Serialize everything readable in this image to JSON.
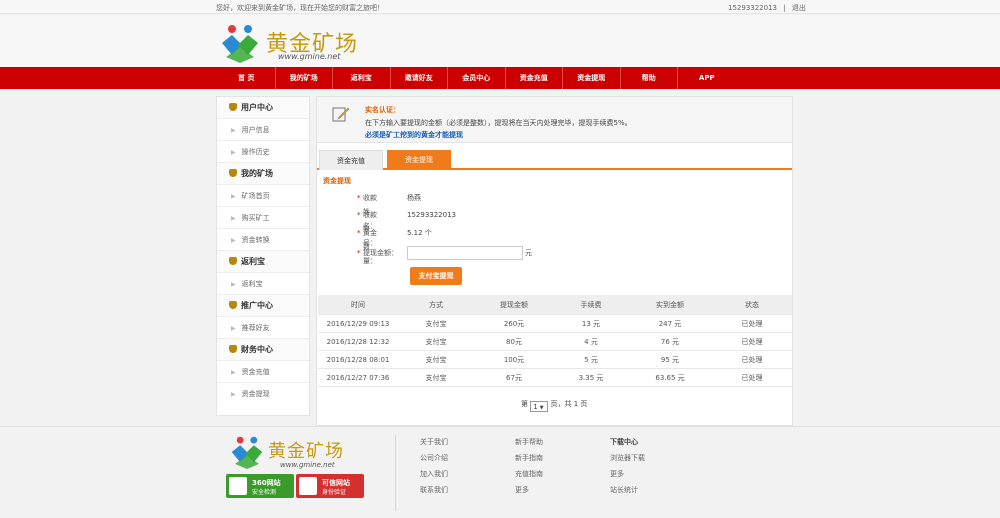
{
  "topbar": {
    "welcome": "您好，欢迎来到黄金矿场，现在开始您的财富之旅吧！",
    "phone": "15293322013",
    "separator": "|",
    "logout": "退出"
  },
  "logo": {
    "title": "黄金矿场",
    "sub": "www.gmine.net"
  },
  "nav": [
    "首 页",
    "我的矿场",
    "返利宝",
    "邀请好友",
    "会员中心",
    "资金充值",
    "资金提现",
    "帮助",
    "APP"
  ],
  "sidebar": {
    "groups": [
      {
        "title": "用户中心",
        "items": [
          "用户信息",
          "操作历史"
        ]
      },
      {
        "title": "我的矿场",
        "items": [
          "矿场首页",
          "购买矿工",
          "资金转换"
        ]
      },
      {
        "title": "返利宝",
        "items": [
          "返利宝"
        ]
      },
      {
        "title": "推广中心",
        "items": [
          "推荐好友"
        ]
      },
      {
        "title": "财务中心",
        "items": [
          "资金充值",
          "资金提现"
        ]
      }
    ]
  },
  "notice": {
    "title": "实名认证：",
    "body": "在下方输入要提现的金额（必须是整数），提现将在当天内处理完毕，提现手续费5%。",
    "emphasis": "必须是矿工挖到的黄金才能提现"
  },
  "tabs": [
    "资金充值",
    "资金提现"
  ],
  "section_title": "资金提现",
  "form": {
    "star": "*",
    "name_label": "收款姓名：",
    "name_value": "杨燕",
    "account_label": "收款账号：",
    "account_value": "15293322013",
    "gold_label": "黄金数量：",
    "gold_value": "5.12 个",
    "amount_label": "提现金额：",
    "amount_value": "",
    "amount_unit": "元",
    "submit": "支付宝提现"
  },
  "table": {
    "headers": [
      "时间",
      "方式",
      "提现金额",
      "手续费",
      "实到金额",
      "状态"
    ],
    "rows": [
      [
        "2016/12/29 09:13",
        "支付宝",
        "260元",
        "13 元",
        "247 元",
        "已处理"
      ],
      [
        "2016/12/28 12:32",
        "支付宝",
        "80元",
        "4 元",
        "76 元",
        "已处理"
      ],
      [
        "2016/12/28 08:01",
        "支付宝",
        "100元",
        "5 元",
        "95 元",
        "已处理"
      ],
      [
        "2016/12/27 07:36",
        "支付宝",
        "67元",
        "3.35 元",
        "63.65 元",
        "已处理"
      ]
    ]
  },
  "pager": {
    "prefix": "第",
    "page": "1",
    "suffix": "页，共 1 页"
  },
  "footer": {
    "logo_title": "黄金矿场",
    "logo_sub": "www.gmine.net",
    "badge1": {
      "l1": "360网站",
      "l2": "安全检测"
    },
    "badge2": {
      "l1": "可信网站",
      "l2": "身份验证"
    },
    "col1": [
      "关于我们",
      "公司介绍",
      "加入我们",
      "联系我们"
    ],
    "col2": [
      "新手帮助",
      "新手指南",
      "充值指南",
      "更多"
    ],
    "col3": [
      "下载中心",
      "浏览器下载",
      "更多",
      "站长统计"
    ]
  },
  "colors": {
    "nav_red": "#cc0000",
    "accent_orange": "#f07b1a",
    "gold": "#c79a10",
    "link_blue": "#1a5fb4"
  }
}
